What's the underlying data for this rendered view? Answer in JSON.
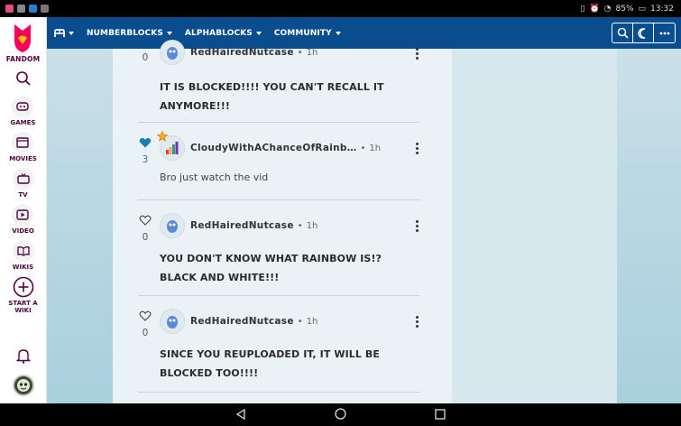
{
  "status_bar": {
    "battery": "85%",
    "time": "13:32"
  },
  "rail": {
    "logo_label": "FANDOM",
    "items": [
      {
        "label": "GAMES",
        "icon": "gamepad-icon"
      },
      {
        "label": "MOVIES",
        "icon": "film-icon"
      },
      {
        "label": "TV",
        "icon": "tv-icon"
      },
      {
        "label": "VIDEO",
        "icon": "video-icon"
      },
      {
        "label": "WIKIS",
        "icon": "book-icon"
      }
    ],
    "start_wiki_line1": "START A",
    "start_wiki_line2": "WIKI"
  },
  "topnav": {
    "items": [
      {
        "label": "NUMBERBLOCKS"
      },
      {
        "label": "ALPHABLOCKS"
      },
      {
        "label": "COMMUNITY"
      }
    ]
  },
  "comments": [
    {
      "author": "RedHairedNutcase",
      "time": "1h",
      "likes": "0",
      "liked": false,
      "text": "IT IS BLOCKED!!!! YOU CAN'T RECALL IT ANYMORE!!!",
      "bold": true
    },
    {
      "author": "CloudyWithAChanceOfRainb…",
      "time": "1h",
      "likes": "3",
      "liked": true,
      "text": "Bro just watch the vid",
      "bold": false
    },
    {
      "author": "RedHairedNutcase",
      "time": "1h",
      "likes": "0",
      "liked": false,
      "text": "YOU DON'T KNOW WHAT RAINBOW IS!? BLACK AND WHITE!!!",
      "bold": true
    },
    {
      "author": "RedHairedNutcase",
      "time": "1h",
      "likes": "0",
      "liked": false,
      "text": "SINCE YOU REUPLOADED IT, IT WILL BE BLOCKED TOO!!!!",
      "bold": true
    }
  ],
  "colors": {
    "nav_bg": "#0a4d8f",
    "fandom_pink": "#fa005a",
    "like_active": "#1c7db5",
    "rail_label": "#520044"
  }
}
